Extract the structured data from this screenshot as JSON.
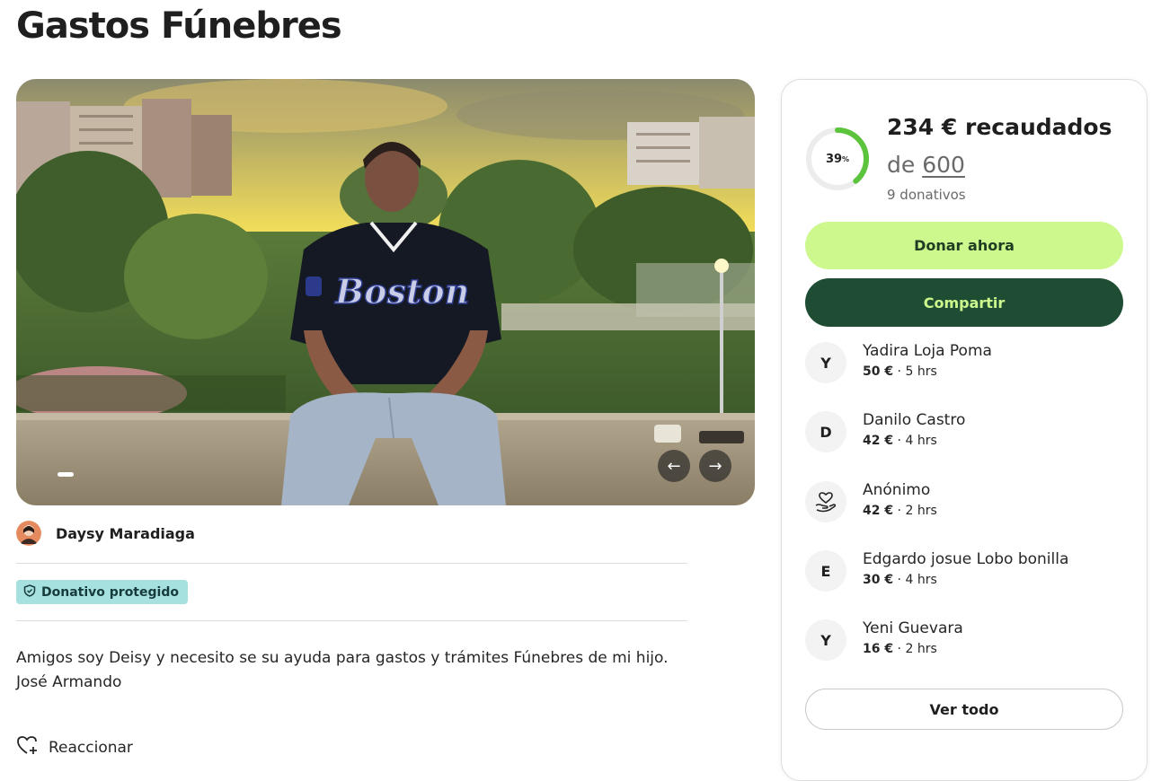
{
  "page": {
    "title": "Gastos Fúnebres"
  },
  "carousel": {
    "prev_icon": "←",
    "next_icon": "→"
  },
  "organizer": {
    "name": "Daysy Maradiaga"
  },
  "badge": {
    "label": "Donativo protegido"
  },
  "story": {
    "line1": "Amigos soy Deisy y necesito se su ayuda para gastos y trámites Fúnebres de mi hijo.",
    "line2": "José Armando"
  },
  "react": {
    "label": "Reaccionar"
  },
  "progress": {
    "percent_label": "39",
    "percent_sup": "%",
    "fraction": 0.39,
    "raised": "234 € recaudados",
    "goal_prefix": "de",
    "goal": "600",
    "count": "9 donativos"
  },
  "buttons": {
    "donate": "Donar ahora",
    "share": "Compartir",
    "see_all": "Ver todo"
  },
  "donations": [
    {
      "initial": "Y",
      "name": "Yadira Loja Poma",
      "amount": "50 €",
      "time": " · 5 hrs"
    },
    {
      "initial": "D",
      "name": "Danilo Castro",
      "amount": "42 €",
      "time": " · 4 hrs"
    },
    {
      "initial": "",
      "name": "Anónimo",
      "amount": "42 €",
      "time": " · 2 hrs"
    },
    {
      "initial": "E",
      "name": "Edgardo josue Lobo bonilla",
      "amount": "30 €",
      "time": " · 4 hrs"
    },
    {
      "initial": "Y",
      "name": "Yeni Guevara",
      "amount": "16 €",
      "time": " · 2 hrs"
    }
  ],
  "colors": {
    "accent_light": "#cdf88e",
    "accent_dark": "#1e4d33",
    "badge": "#a6e0df",
    "ring": "#5cc43c"
  }
}
